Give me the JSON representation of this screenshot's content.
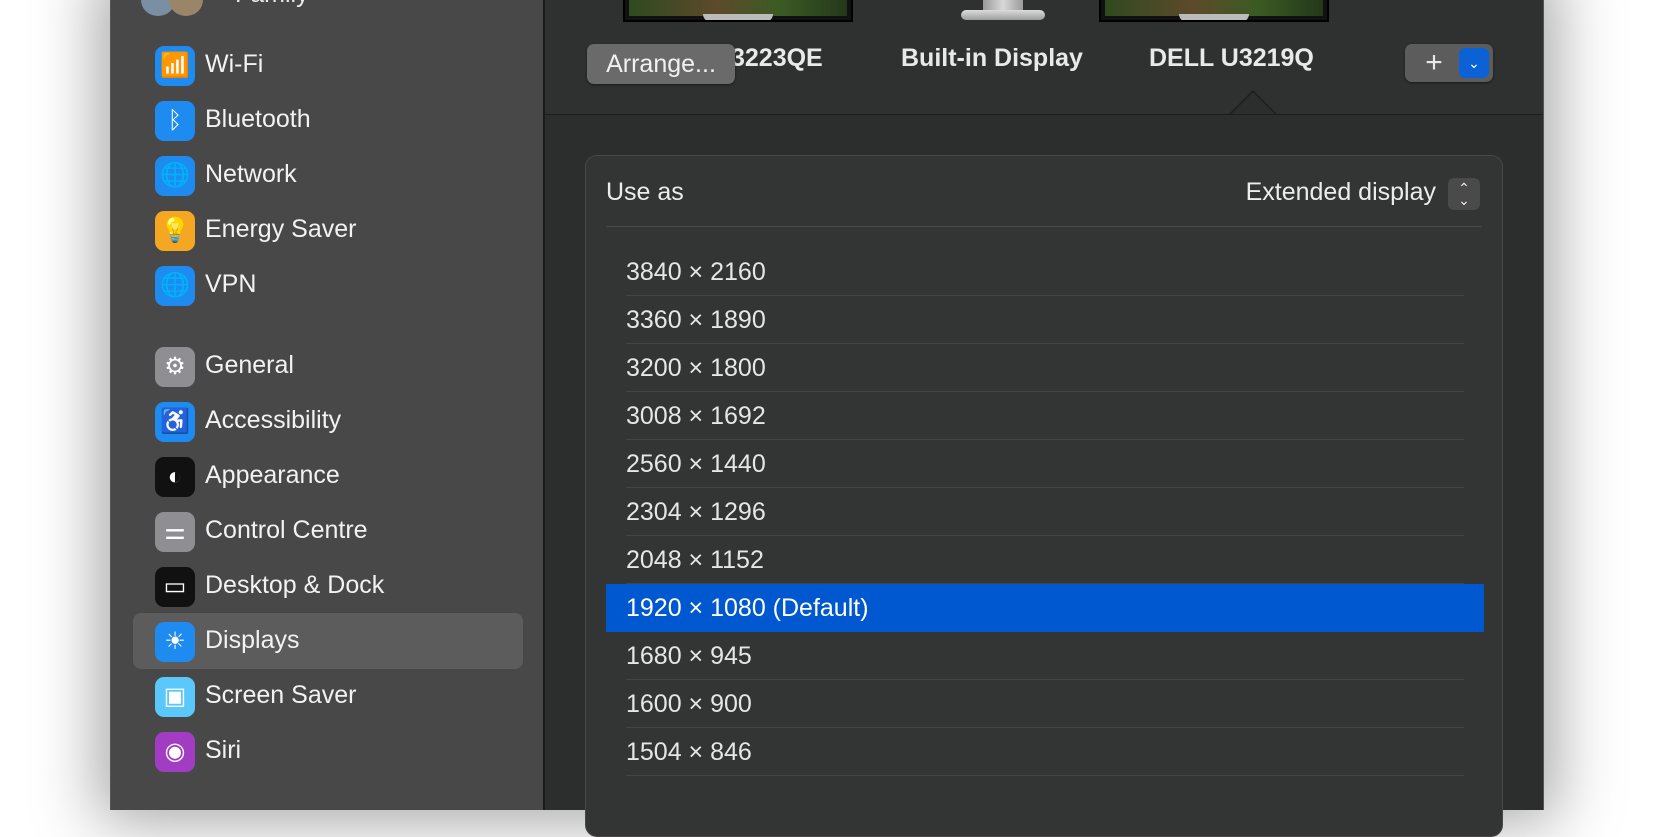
{
  "sidebar": {
    "family_label": "Family",
    "items": [
      {
        "name": "sidebar-item-wifi",
        "label": "Wi-Fi",
        "icon": "wifi-icon",
        "icon_glyph": "📶",
        "color": "#1e8bf0"
      },
      {
        "name": "sidebar-item-bluetooth",
        "label": "Bluetooth",
        "icon": "bluetooth-icon",
        "icon_glyph": "ᛒ",
        "color": "#1e8bf0"
      },
      {
        "name": "sidebar-item-network",
        "label": "Network",
        "icon": "globe-icon",
        "icon_glyph": "🌐",
        "color": "#1e8bf0"
      },
      {
        "name": "sidebar-item-energy-saver",
        "label": "Energy Saver",
        "icon": "lightbulb-icon",
        "icon_glyph": "💡",
        "color": "#f5a623"
      },
      {
        "name": "sidebar-item-vpn",
        "label": "VPN",
        "icon": "vpn-globe-icon",
        "icon_glyph": "🌐",
        "color": "#1e8bf0"
      },
      {
        "name": "sidebar-item-general",
        "label": "General",
        "icon": "gear-icon",
        "icon_glyph": "⚙",
        "color": "#8e8e93"
      },
      {
        "name": "sidebar-item-accessibility",
        "label": "Accessibility",
        "icon": "accessibility-icon",
        "icon_glyph": "♿",
        "color": "#1e8bf0"
      },
      {
        "name": "sidebar-item-appearance",
        "label": "Appearance",
        "icon": "appearance-icon",
        "icon_glyph": "◐",
        "color": "#111111"
      },
      {
        "name": "sidebar-item-control-centre",
        "label": "Control Centre",
        "icon": "toggles-icon",
        "icon_glyph": "⚌",
        "color": "#8e8e93"
      },
      {
        "name": "sidebar-item-desktop-dock",
        "label": "Desktop & Dock",
        "icon": "dock-icon",
        "icon_glyph": "▭",
        "color": "#111111"
      },
      {
        "name": "sidebar-item-displays",
        "label": "Displays",
        "icon": "sun-icon",
        "icon_glyph": "☀",
        "color": "#1e8bf0",
        "selected": true
      },
      {
        "name": "sidebar-item-screen-saver",
        "label": "Screen Saver",
        "icon": "screen-saver-icon",
        "icon_glyph": "▣",
        "color": "#5ac8fa"
      },
      {
        "name": "sidebar-item-siri",
        "label": "Siri",
        "icon": "siri-icon",
        "icon_glyph": "◉",
        "color": "#a23cc2"
      }
    ]
  },
  "displays": {
    "partial_label": "3223QE",
    "builtin_label": "Built-in Display",
    "selected_label": "DELL U3219Q",
    "arrange_label": "Arrange...",
    "add_label": "+",
    "add_menu_icon": "chevron-down-icon"
  },
  "settings": {
    "use_as_label": "Use as",
    "use_as_value": "Extended display"
  },
  "resolutions": [
    {
      "label": "3840 × 2160"
    },
    {
      "label": "3360 × 1890"
    },
    {
      "label": "3200 × 1800"
    },
    {
      "label": "3008 × 1692"
    },
    {
      "label": "2560 × 1440"
    },
    {
      "label": "2304 × 1296"
    },
    {
      "label": "2048 × 1152"
    },
    {
      "label": "1920 × 1080 (Default)",
      "selected": true
    },
    {
      "label": "1680 × 945"
    },
    {
      "label": "1600 × 900"
    },
    {
      "label": "1504 × 846"
    }
  ],
  "colors": {
    "accent": "#0058d0",
    "sidebar_bg": "#484848",
    "window_bg": "#2c2d2d"
  }
}
